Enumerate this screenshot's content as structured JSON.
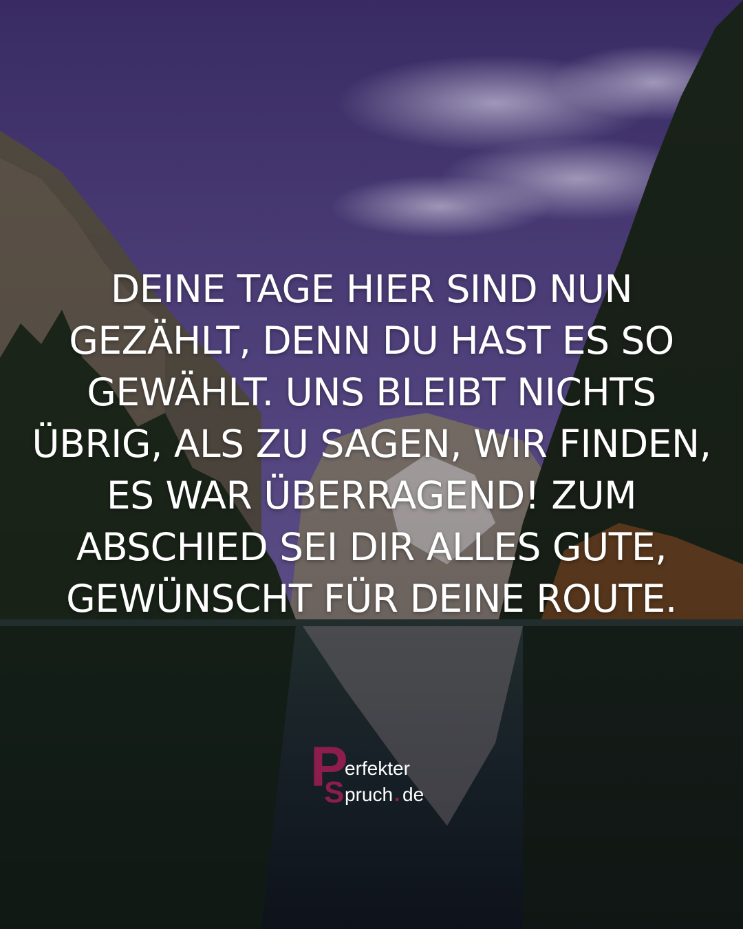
{
  "quote": {
    "text": "Deine Tage hier sind nun gezählt, denn du hast es so gewählt. Uns bleibt nichts übrig, als zu sagen, wir finden, es war überragend! Zum Abschied sei dir alles Gute, gewünscht für deine Route."
  },
  "logo": {
    "initial_p": "P",
    "initial_s": "S",
    "word1": "erfekter",
    "word2": "pruch",
    "dot": ".",
    "tld": "de",
    "brand_color": "#8c1d4d",
    "text_color": "#ffffff"
  },
  "colors": {
    "sky_top": "#4d3a7d",
    "sky_mid": "#7a67a9",
    "forest": "#1f2a1f",
    "water": "#1a2030"
  }
}
